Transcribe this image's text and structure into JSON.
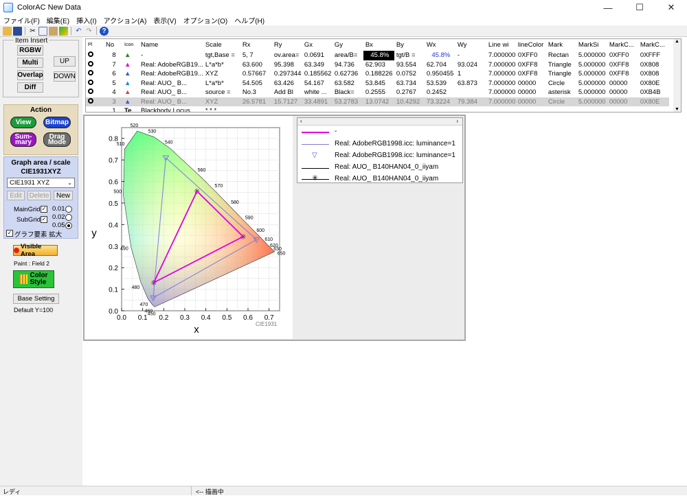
{
  "window": {
    "title": "ColorAC  New Data"
  },
  "menu": [
    "ファイル(F)",
    "編集(E)",
    "挿入(I)",
    "アクション(A)",
    "表示(V)",
    "オプション(O)",
    "ヘルプ(H)"
  ],
  "left": {
    "item_insert_label": "Item Insert",
    "rgbw": "RGBW",
    "multi": "Multi",
    "overlap": "Overlap",
    "diff": "Diff",
    "up": "UP",
    "down": "DOWN",
    "action_label": "Action",
    "view": "View",
    "bitmap": "Bitmap",
    "summary_1": "Sum-",
    "summary_2": "mary",
    "drag_1": "Drag",
    "drag_2": "Mode",
    "graph_area_label": "Graph area / scale",
    "graph_type": "CIE1931XYZ",
    "select_value": "CIE1931 XYZ",
    "edit": "Edit",
    "delete": "Delete",
    "new": "New",
    "main_grid": "MainGrid",
    "sub_grid": "SubGrid",
    "g001": "0.01",
    "g002": "0.02",
    "g005": "0.05",
    "enlarge": "グラフ要素 拡大",
    "visible_area": "Visible Area",
    "paint_field": "Paint : Field 2",
    "color_1": "Color",
    "color_2": "Style",
    "base_setting": "Base Setting",
    "default_y": "Default Y=100"
  },
  "table": {
    "headers": [
      "No",
      "Name",
      "Scale",
      "Rx",
      "Ry",
      "Gx",
      "Gy",
      "Bx",
      "By",
      "Wx",
      "Wy",
      "Line wi",
      "lineColor",
      "Mark",
      "MarkSi",
      "MarkC...",
      "MarkC..."
    ],
    "rows": [
      [
        "8",
        "-",
        "tgt,Base =",
        "5, 7",
        "ov.area=",
        "0.0691",
        "area/B=",
        "45.8%",
        "tgt/B =",
        "45.8%",
        "-",
        "7.000000",
        "0XFF0",
        "Rectan",
        "5.000000",
        "0XFF0",
        "0XFFF"
      ],
      [
        "7",
        "Real: AdobeRGB19...",
        "L*a*b*",
        "63.600",
        "95.398",
        "63.349",
        "94.736",
        "62.903",
        "93.554",
        "62.704",
        "93.024",
        "7.000000",
        "0XFF8",
        "Triangle",
        "5.000000",
        "0XFF8",
        "0X808"
      ],
      [
        "6",
        "Real: AdobeRGB19...",
        "XYZ",
        "0.57667",
        "0.297344",
        "0.185562",
        "0.62736",
        "0.188226",
        "0.0752",
        "0.950455",
        "1",
        "7.000000",
        "0XFF8",
        "Triangle",
        "5.000000",
        "0XFF8",
        "0X808"
      ],
      [
        "5",
        "Real: AUO_        B...",
        "L*a*b*",
        "54.505",
        "63.426",
        "54.167",
        "63.582",
        "53.845",
        "63.734",
        "53.539",
        "63.873",
        "7.000000",
        "00000",
        "Circle",
        "5.000000",
        "00000",
        "0X80E"
      ],
      [
        "4",
        "Real: AUO_        B...",
        "source =",
        "No.3",
        "Add Bl",
        "white ...",
        "Black=",
        "0.2555",
        "0.2767",
        "0.2452",
        "",
        "7.000000",
        "00000",
        "asterisk",
        "5.000000",
        "00000",
        "0XB4B"
      ],
      [
        "3",
        "Real: AUO_        B...",
        "XYZ",
        "26.5781",
        "15.7127",
        "33.4891",
        "53.2783",
        "13.0742",
        "10.4292",
        "73.3224",
        "79.384",
        "7.000000",
        "00000",
        "Circle",
        "5.000000",
        "00000",
        "0X80E"
      ],
      [
        "1",
        "Blackbody Locus",
        "* * *",
        "",
        "",
        "",
        "",
        "",
        "",
        "",
        "",
        "",
        "",
        "",
        "",
        "",
        ""
      ]
    ]
  },
  "legend": {
    "entries": [
      "-",
      "Real: AdobeRGB1998.icc: luminance=1",
      "Real: AdobeRGB1998.icc: luminance=1",
      "Real: AUO_        B140HAN04_0_iiyam",
      "Real: AUO_        B140HAN04_0_iiyam"
    ]
  },
  "chart_data": {
    "type": "scatter",
    "title": "",
    "xlabel": "x",
    "ylabel": "y",
    "xlim": [
      0.0,
      0.75
    ],
    "ylim": [
      0.0,
      0.85
    ],
    "x_ticks": [
      "0.0",
      "0.1",
      "0.2",
      "0.3",
      "0.4",
      "0.5",
      "0.6",
      "0.7"
    ],
    "y_ticks": [
      "0.0",
      "0.1",
      "0.2",
      "0.3",
      "0.4",
      "0.5",
      "0.6",
      "0.7",
      "0.8"
    ],
    "grid": true,
    "corner_label": "CIE1931",
    "locus_labels": [
      {
        "nm": "450",
        "x": 0.157,
        "y": 0.018
      },
      {
        "nm": "460",
        "x": 0.144,
        "y": 0.03
      },
      {
        "nm": "470",
        "x": 0.124,
        "y": 0.058
      },
      {
        "nm": "480",
        "x": 0.091,
        "y": 0.133
      },
      {
        "nm": "490",
        "x": 0.045,
        "y": 0.295
      },
      {
        "nm": "500",
        "x": 0.008,
        "y": 0.538
      },
      {
        "nm": "510",
        "x": 0.014,
        "y": 0.75
      },
      {
        "nm": "520",
        "x": 0.074,
        "y": 0.834
      },
      {
        "nm": "530",
        "x": 0.155,
        "y": 0.806
      },
      {
        "nm": "540",
        "x": 0.23,
        "y": 0.754
      },
      {
        "nm": "560",
        "x": 0.373,
        "y": 0.624
      },
      {
        "nm": "570",
        "x": 0.444,
        "y": 0.555
      },
      {
        "nm": "580",
        "x": 0.512,
        "y": 0.487
      },
      {
        "nm": "590",
        "x": 0.575,
        "y": 0.424
      },
      {
        "nm": "600",
        "x": 0.627,
        "y": 0.372
      },
      {
        "nm": "610",
        "x": 0.666,
        "y": 0.334
      },
      {
        "nm": "620",
        "x": 0.691,
        "y": 0.308
      },
      {
        "nm": "630",
        "x": 0.708,
        "y": 0.292
      },
      {
        "nm": "650",
        "x": 0.726,
        "y": 0.274
      }
    ],
    "series": [
      {
        "name": "Real: AdobeRGB1998.icc: luminance=1",
        "points": [
          [
            0.64,
            0.33
          ],
          [
            0.21,
            0.71
          ],
          [
            0.15,
            0.06
          ]
        ],
        "color": "#7b7bdc"
      },
      {
        "name": "Real: AUO_        B140HAN04_0_iiyam",
        "points": [
          [
            0.577,
            0.344
          ],
          [
            0.358,
            0.555
          ],
          [
            0.153,
            0.131
          ]
        ],
        "color": "#000000"
      },
      {
        "name": "-",
        "points": [
          [
            0.577,
            0.344
          ],
          [
            0.358,
            0.555
          ],
          [
            0.153,
            0.131
          ]
        ],
        "color": "#e000e0"
      }
    ]
  },
  "status": {
    "left": "レディ",
    "mid": "<-- 描画中"
  }
}
